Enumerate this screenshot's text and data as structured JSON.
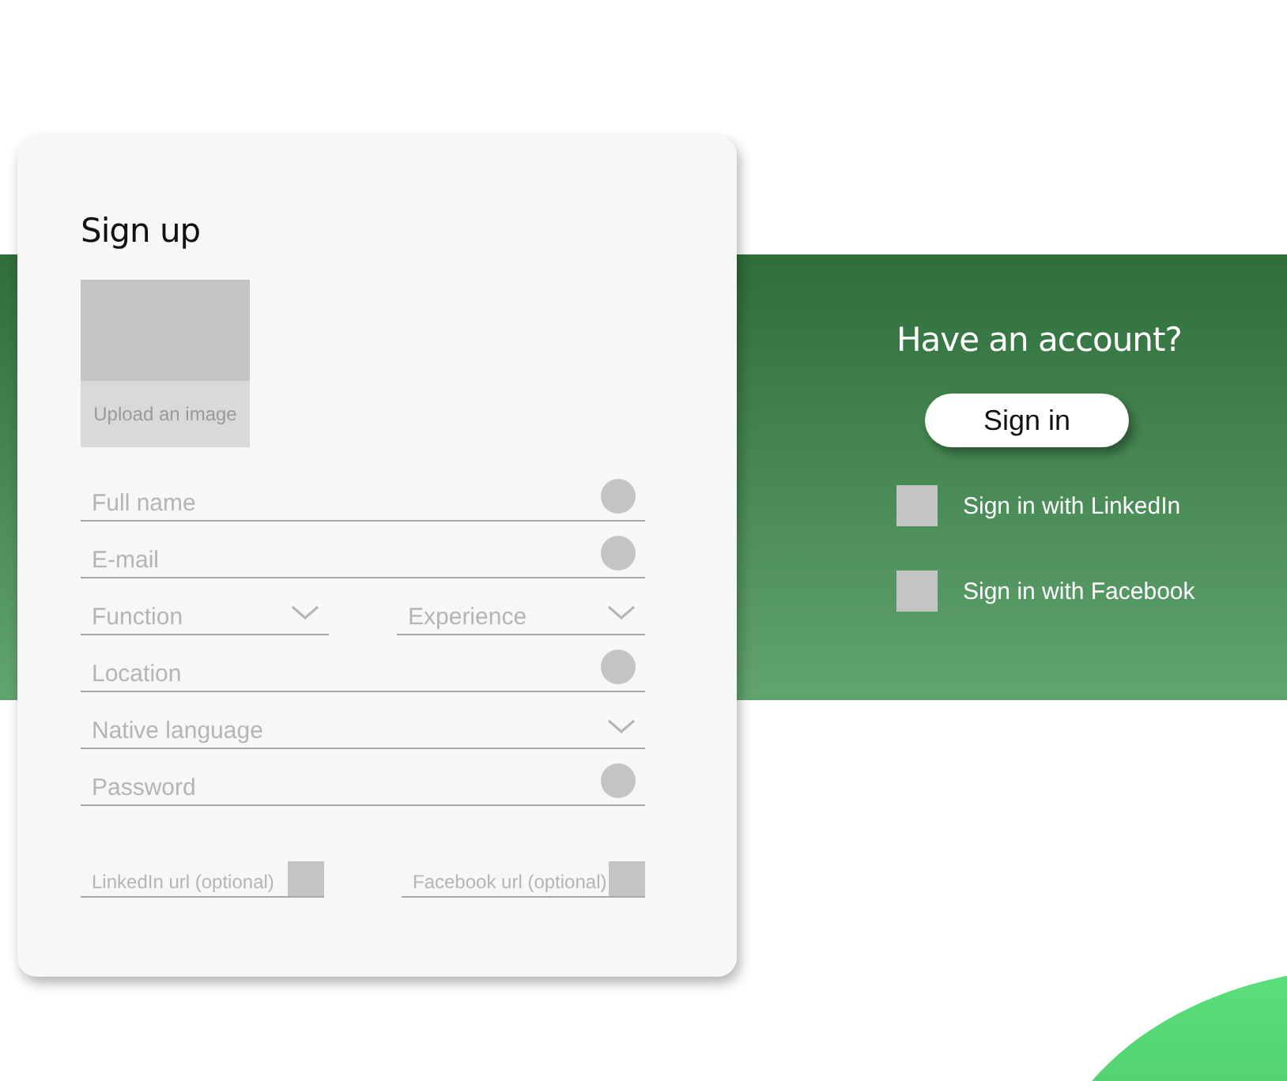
{
  "signup": {
    "title": "Sign up",
    "upload_label": "Upload an image",
    "rows": [
      [
        {
          "kind": "text",
          "placeholder": "Full name"
        }
      ],
      [
        {
          "kind": "text",
          "placeholder": "E-mail"
        }
      ],
      [
        {
          "kind": "select",
          "placeholder": "Function"
        },
        {
          "kind": "select",
          "placeholder": "Experience"
        }
      ],
      [
        {
          "kind": "text",
          "placeholder": "Location"
        }
      ],
      [
        {
          "kind": "select",
          "placeholder": "Native language"
        }
      ],
      [
        {
          "kind": "text",
          "placeholder": "Password"
        }
      ],
      [
        {
          "kind": "url",
          "placeholder": "LinkedIn url (optional)"
        },
        {
          "kind": "url",
          "placeholder": "Facebook url (optional)"
        }
      ]
    ]
  },
  "signin": {
    "title": "Have an account?",
    "button": "Sign in",
    "options": [
      {
        "label": "Sign in with LinkedIn"
      },
      {
        "label": "Sign in with Facebook"
      }
    ]
  }
}
